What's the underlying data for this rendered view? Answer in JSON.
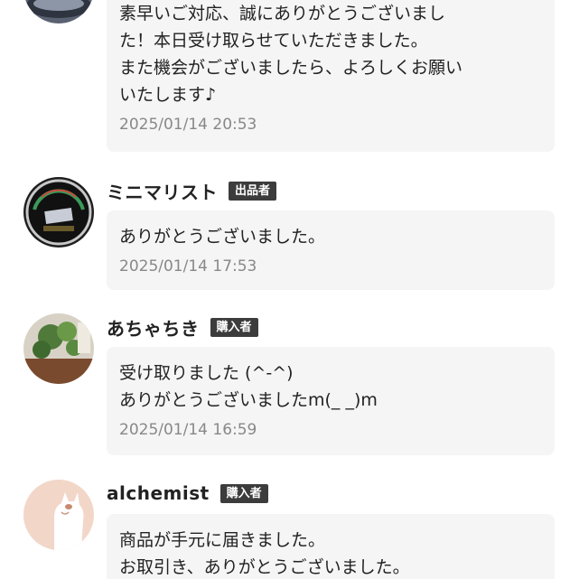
{
  "comments": [
    {
      "name": "",
      "role": "",
      "lines": [
        "素早いご対応、誠にありがとうございまし",
        "た！本日受け取らせていただきました。",
        "また機会がございましたら、よろしくお願い",
        "いたします♪"
      ],
      "time": "2025/01/14 20:53",
      "avatar": "car-photo-avatar"
    },
    {
      "name": "ミニマリスト",
      "role": "出品者",
      "lines": [
        "ありがとうございました。"
      ],
      "time": "2025/01/14 17:53",
      "avatar": "gauge-photo-avatar"
    },
    {
      "name": "あちゃちき",
      "role": "購入者",
      "lines": [
        "受け取りました (^-^)",
        "ありがとうございましたm(_ _)m"
      ],
      "time": "2025/01/14 16:59",
      "avatar": "plant-photo-avatar"
    },
    {
      "name": "alchemist",
      "role": "購入者",
      "lines": [
        "商品が手元に届きました。",
        "お取引き、ありがとうございました。"
      ],
      "time": "",
      "avatar": "cat-illustration-avatar"
    }
  ],
  "colors": {
    "bubble_bg": "#f5f5f5",
    "badge_bg": "#3c3c3c",
    "timestamp": "#888888"
  }
}
